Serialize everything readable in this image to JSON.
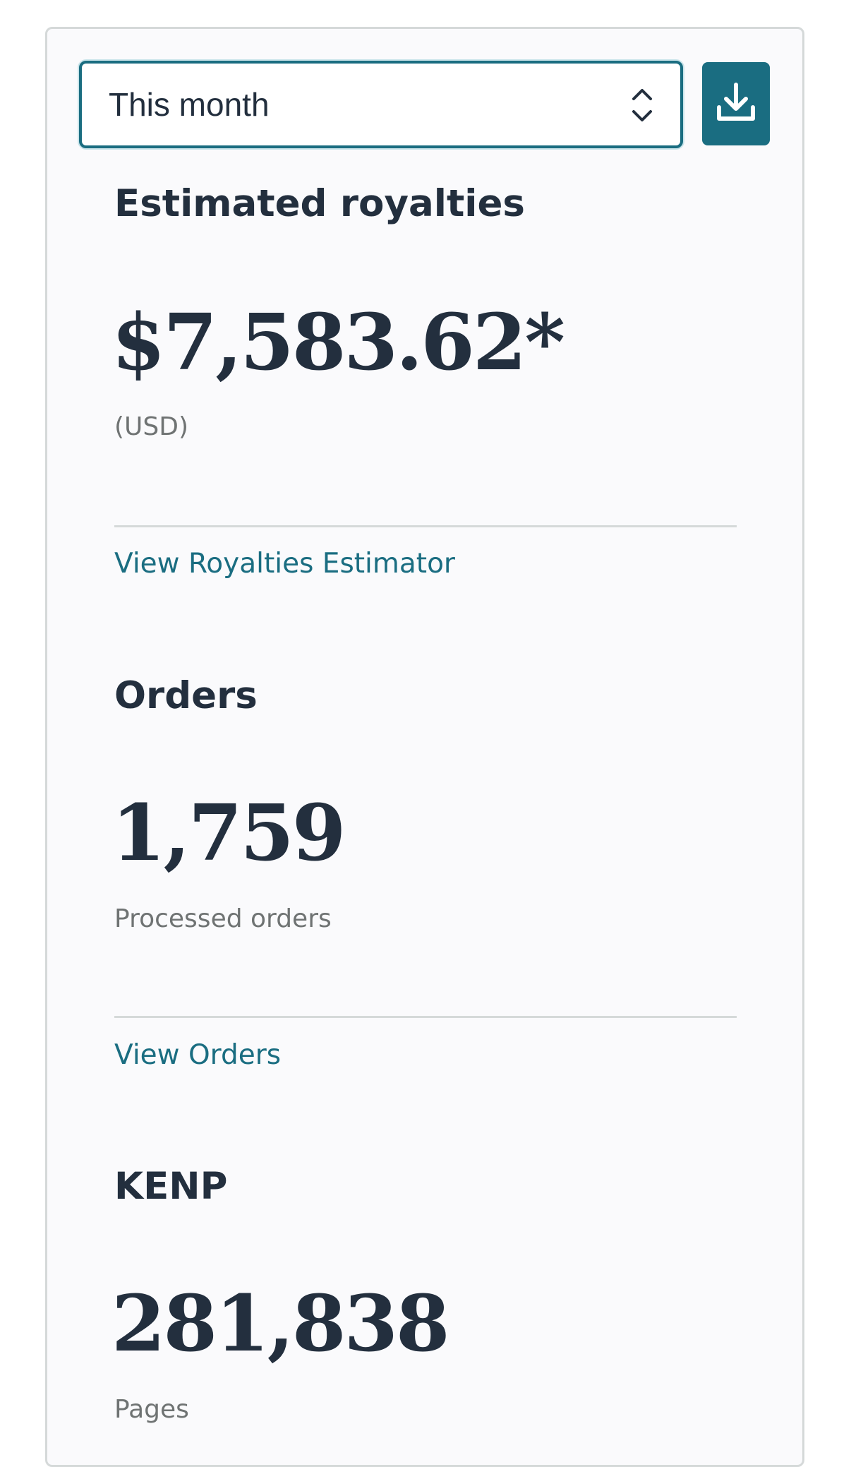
{
  "period_select": {
    "value": "This month"
  },
  "download_button": {
    "icon": "download-icon"
  },
  "colors": {
    "accent": "#1a6d81",
    "text": "#232f3e",
    "muted": "#6f7373",
    "divider": "#d5d9d9"
  },
  "royalties": {
    "heading": "Estimated royalties",
    "amount": "$7,583.62*",
    "currency": "(USD)",
    "link": "View Royalties Estimator"
  },
  "orders": {
    "heading": "Orders",
    "count": "1,759",
    "caption": "Processed orders",
    "link": "View Orders"
  },
  "kenp": {
    "heading": "KENP",
    "count": "281,838",
    "caption": "Pages"
  }
}
